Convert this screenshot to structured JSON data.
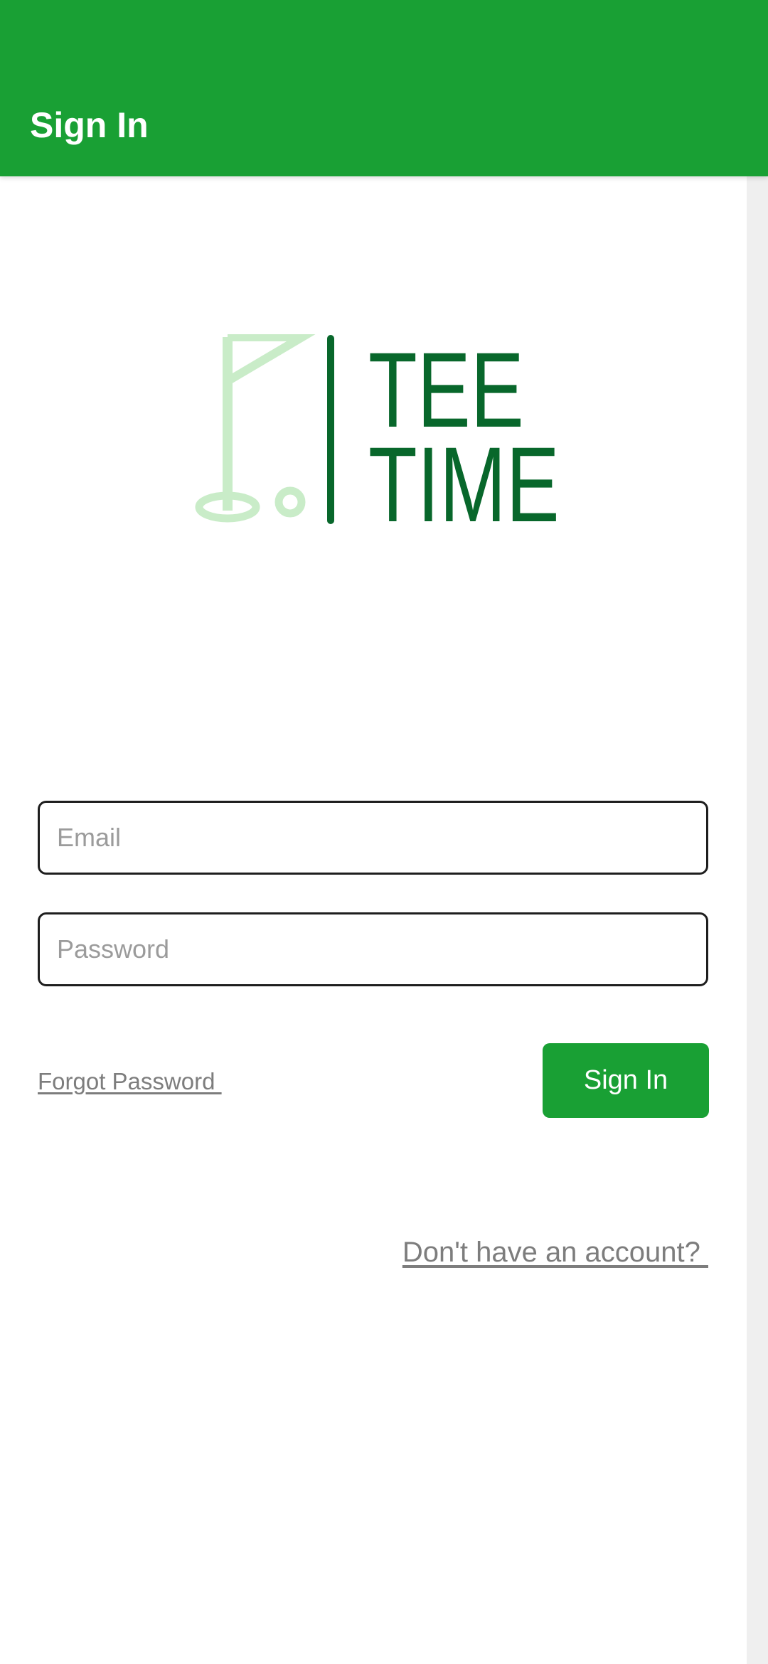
{
  "app_bar": {
    "title": "Sign In"
  },
  "logo": {
    "line1": "TEE",
    "line2": "TIME",
    "icon": "golf-flag-icon",
    "colors": {
      "flag": "#c9ecc8",
      "text": "#08672b"
    }
  },
  "form": {
    "email_placeholder": "Email",
    "password_placeholder": "Password",
    "forgot_password_label": "Forgot Password ",
    "signin_label": "Sign In",
    "signup_link_label": "Don't have an account? "
  },
  "colors": {
    "primary": "#19a034",
    "link": "#7d7d7d",
    "field_border": "#1e1e1e"
  }
}
